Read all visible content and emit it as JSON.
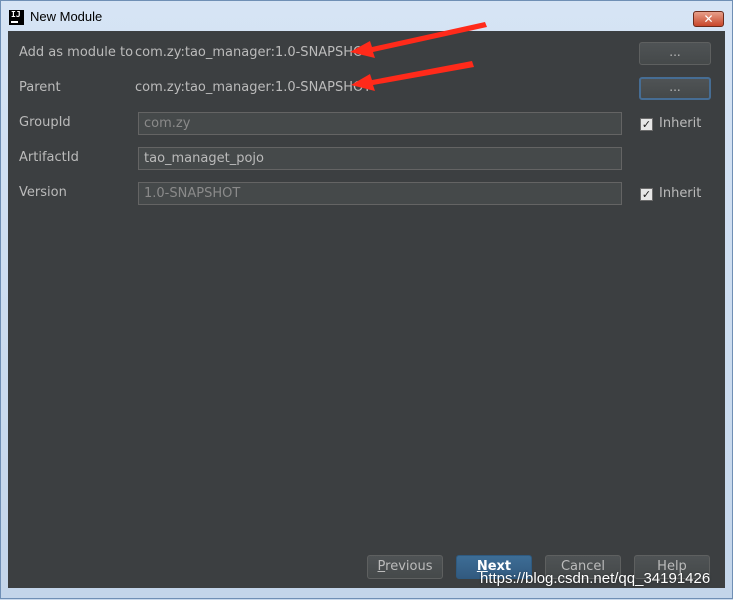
{
  "window": {
    "title": "New Module",
    "app_icon_text": "IJ",
    "close_glyph": "✕"
  },
  "form": {
    "add_as_module_to": {
      "label": "Add as module to",
      "value": "com.zy:tao_manager:1.0-SNAPSHOT",
      "browse_label": "..."
    },
    "parent": {
      "label": "Parent",
      "value": "com.zy:tao_manager:1.0-SNAPSHOT",
      "browse_label": "..."
    },
    "group_id": {
      "label": "GroupId",
      "value": "com.zy",
      "inherit_label": "Inherit",
      "inherit_checked": true
    },
    "artifact_id": {
      "label": "ArtifactId",
      "value": "tao_managet_pojo"
    },
    "version": {
      "label": "Version",
      "value": "1.0-SNAPSHOT",
      "inherit_label": "Inherit",
      "inherit_checked": true
    }
  },
  "buttons": {
    "previous": {
      "mnemonic": "P",
      "rest": "revious"
    },
    "next": {
      "mnemonic": "N",
      "rest": "ext"
    },
    "cancel": "Cancel",
    "help": "Help"
  },
  "check_glyph": "✓",
  "watermark": "https://blog.csdn.net/qq_34191426",
  "colors": {
    "dialog_bg": "#3c3f41",
    "primary_button": "#365880",
    "annotation_arrow": "#ff2a1a",
    "text": "#bbbbbb"
  }
}
